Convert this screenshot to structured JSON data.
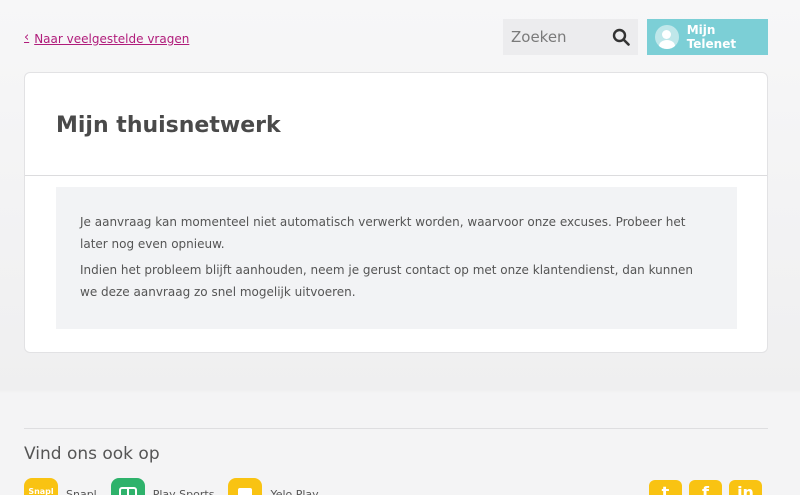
{
  "header": {
    "back_label": "Naar veelgestelde vragen",
    "search_placeholder": "Zoeken",
    "account_label": "Mijn Telenet"
  },
  "card": {
    "title": "Mijn thuisnetwerk",
    "paragraphs": [
      "Je aanvraag kan momenteel niet automatisch verwerkt worden, waarvoor onze excuses. Probeer het later nog even opnieuw.",
      "Indien het probleem blijft aanhouden, neem je gerust contact op met onze klantendienst, dan kunnen we deze aanvraag zo snel mogelijk uitvoeren."
    ]
  },
  "footer": {
    "title": "Vind ons ook op",
    "apps": [
      {
        "label": "Snapl",
        "icon_text": "Snapl",
        "color": "#f9c312",
        "icon": "snapl-icon"
      },
      {
        "label": "Play Sports",
        "icon_text": "",
        "color": "#2eb26b",
        "icon": "play-sports-icon"
      },
      {
        "label": "Yelo Play",
        "icon_text": "",
        "color": "#f9c312",
        "icon": "yelo-play-icon"
      }
    ],
    "social": [
      {
        "name": "twitter-icon",
        "glyph": "t"
      },
      {
        "name": "facebook-icon",
        "glyph": "f"
      },
      {
        "name": "linkedin-icon",
        "glyph": "in"
      }
    ]
  },
  "colors": {
    "accent": "#b01c7b",
    "account_button": "#7ccfd6",
    "social": "#f9c312"
  }
}
